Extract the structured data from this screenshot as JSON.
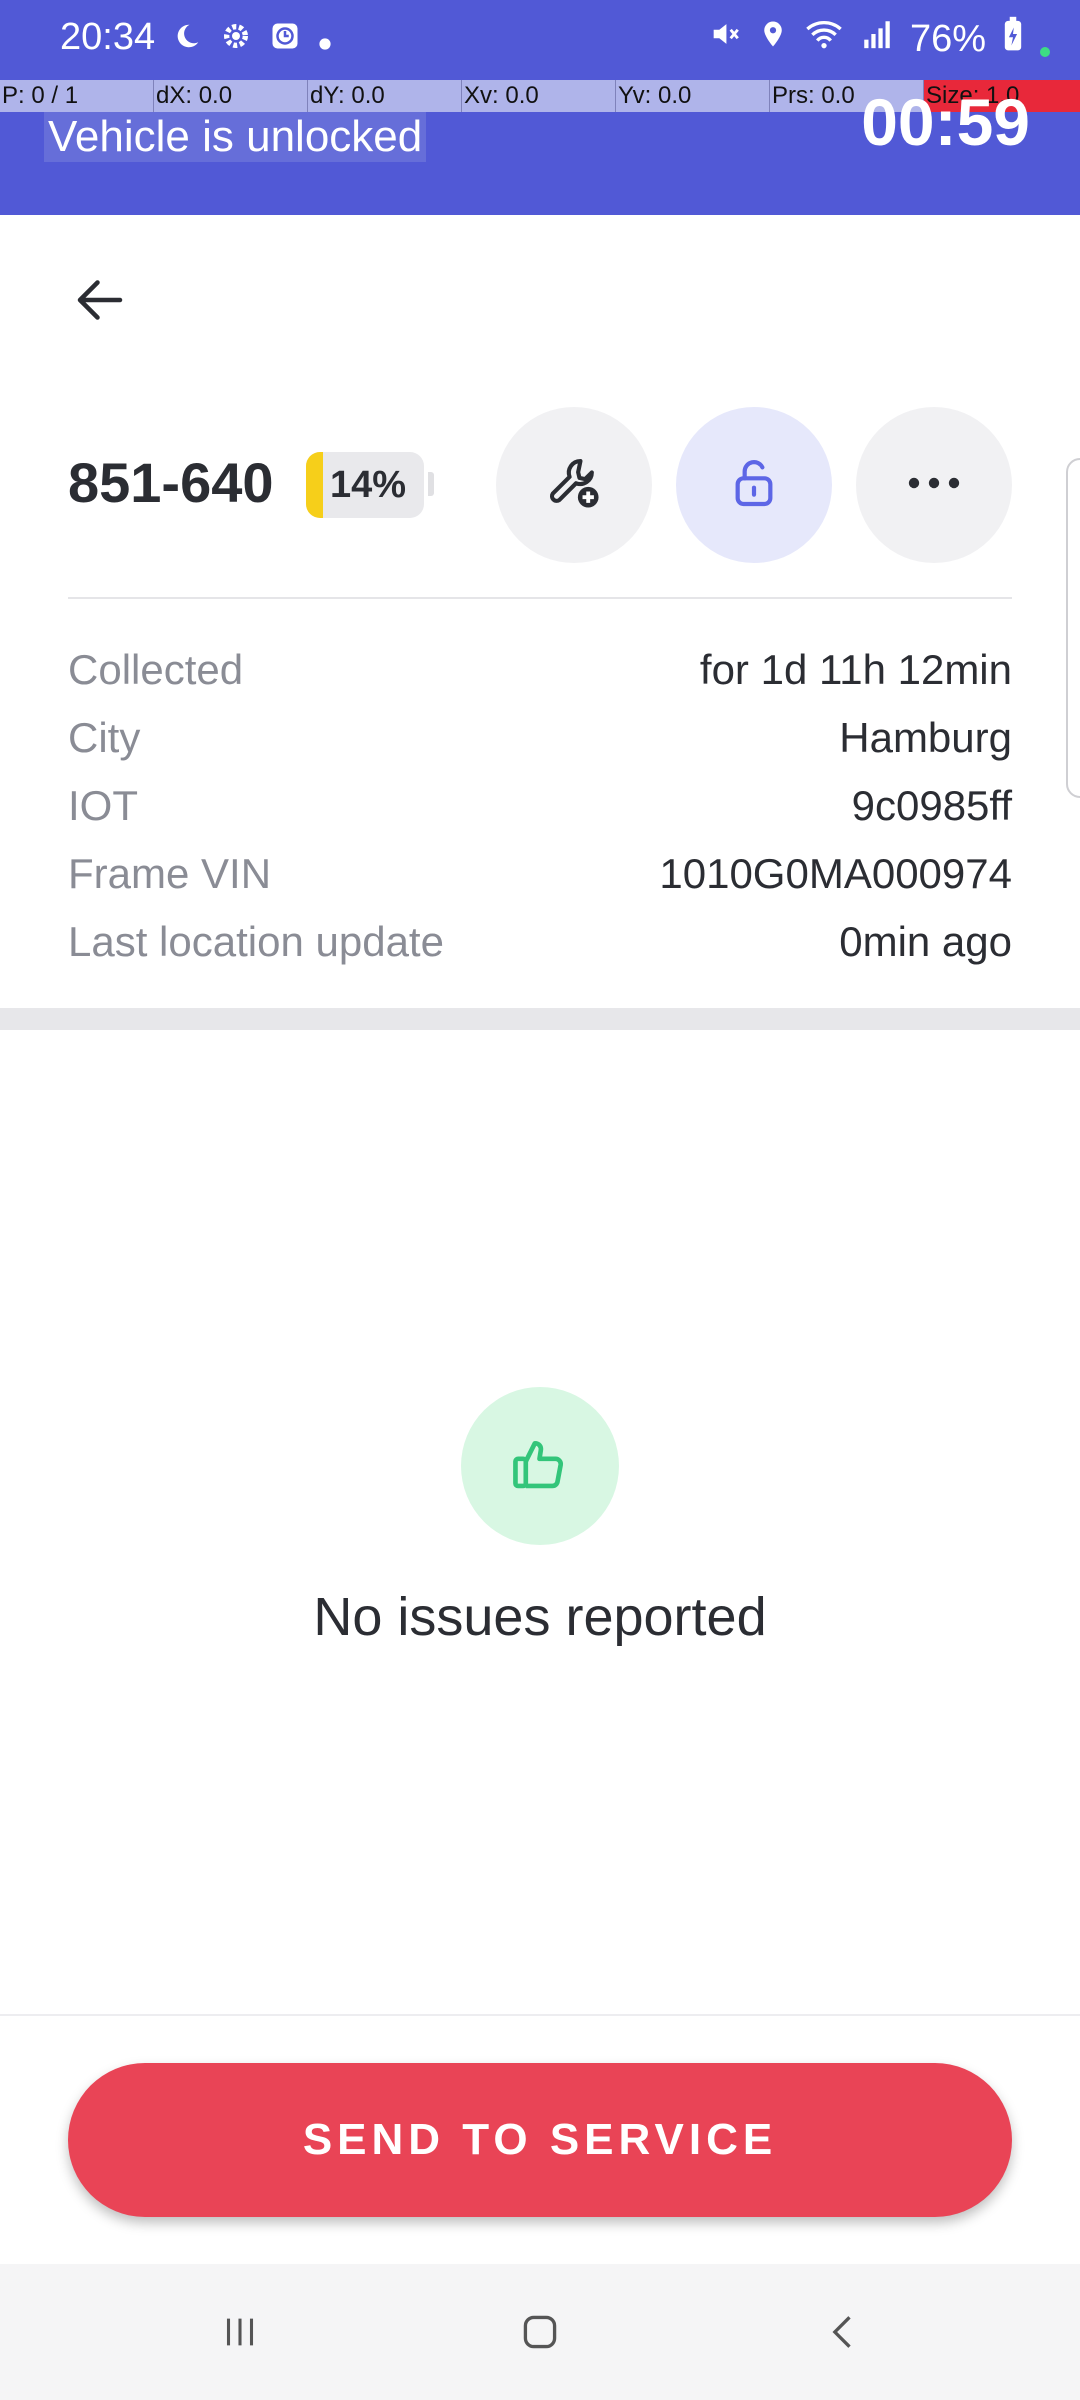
{
  "status_bar": {
    "time": "20:34",
    "battery_percent": "76%",
    "icons": [
      "moon-icon",
      "gear-icon",
      "clock-icon",
      "dot-icon",
      "mute-icon",
      "location-icon",
      "wifi-icon",
      "signal-icon",
      "battery-icon"
    ]
  },
  "debug_overlay": {
    "cells": [
      "P: 0 / 1",
      "dX: 0.0",
      "dY: 0.0",
      "Xv: 0.0",
      "Yv: 0.0",
      "Prs: 0.0",
      "Size: 1.0"
    ]
  },
  "banner": {
    "message": "Vehicle is unlocked",
    "timer": "00:59"
  },
  "vehicle": {
    "id": "851-640",
    "battery_label": "14%",
    "battery_level": 0.14
  },
  "actions": {
    "maintenance_icon": "wrench-plus-icon",
    "unlock_icon": "unlock-icon",
    "more_icon": "more-icon"
  },
  "info": [
    {
      "label": "Collected",
      "value": "for 1d 11h 12min"
    },
    {
      "label": "City",
      "value": "Hamburg"
    },
    {
      "label": "IOT",
      "value": "9c0985ff"
    },
    {
      "label": "Frame VIN",
      "value": "1010G0MA000974"
    },
    {
      "label": "Last location update",
      "value": "0min ago"
    }
  ],
  "issues": {
    "empty_text": "No issues reported",
    "icon": "thumbs-up-icon"
  },
  "footer": {
    "send_label": "SEND TO SERVICE"
  },
  "colors": {
    "brand": "#5159d6",
    "danger": "#e94456",
    "battery_low": "#f6cf1a",
    "success_bg": "#d8f7e3",
    "success": "#33c57a"
  }
}
